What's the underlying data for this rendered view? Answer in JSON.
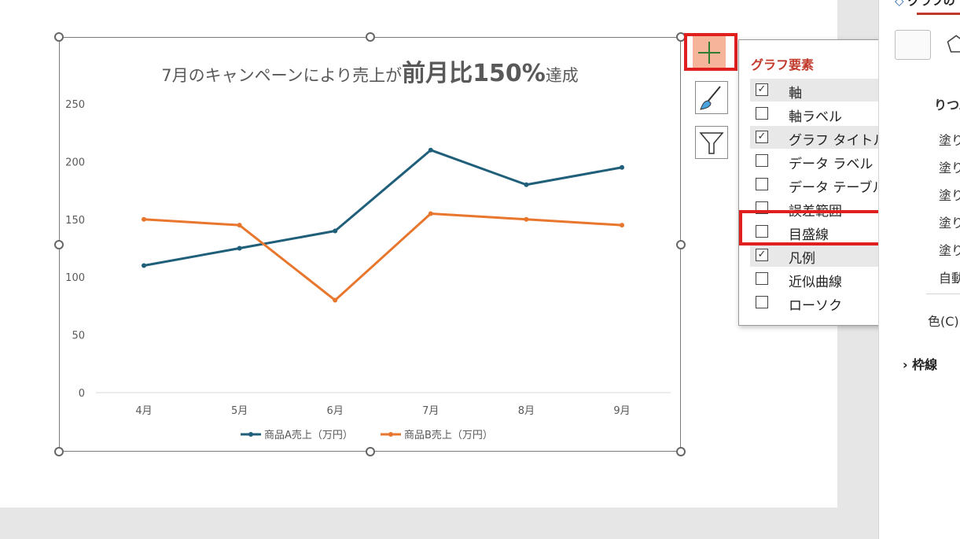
{
  "chart": {
    "title_normal": "7月のキャンペーンにより売上が",
    "title_bold": "前月比150%",
    "title_tail": "達成"
  },
  "chart_data": {
    "type": "line",
    "categories": [
      "4月",
      "5月",
      "6月",
      "7月",
      "8月",
      "9月"
    ],
    "series": [
      {
        "name": "商品A売上（万円）",
        "color": "#1f5f7a",
        "values": [
          110,
          125,
          140,
          210,
          180,
          195
        ]
      },
      {
        "name": "商品B売上（万円）",
        "color": "#e8762d",
        "values": [
          150,
          145,
          80,
          155,
          150,
          145
        ]
      }
    ],
    "yticks": [
      0,
      50,
      100,
      150,
      200,
      250
    ],
    "ylim": [
      0,
      250
    ],
    "grid": false,
    "legend_position": "bottom",
    "title": "7月のキャンペーンにより売上が前月比150%達成"
  },
  "side_buttons": {
    "add_element": "chart-elements-plus-icon",
    "styles": "paintbrush-icon",
    "filter": "funnel-icon"
  },
  "popup": {
    "title": "グラフ要素",
    "items": [
      {
        "label": "軸",
        "checked": true
      },
      {
        "label": "軸ラベル",
        "checked": false
      },
      {
        "label": "グラフ タイトル",
        "checked": true
      },
      {
        "label": "データ ラベル",
        "checked": false
      },
      {
        "label": "データ テーブル",
        "checked": false
      },
      {
        "label": "誤差範囲",
        "checked": false
      },
      {
        "label": "目盛線",
        "checked": false
      },
      {
        "label": "凡例",
        "checked": true
      },
      {
        "label": "近似曲線",
        "checked": false
      },
      {
        "label": "ローソク",
        "checked": false
      }
    ],
    "gridlines_chevron": ">"
  },
  "right_pane": {
    "title": "グラフの",
    "section": "りつぶ",
    "rows": [
      "塗り",
      "塗り",
      "塗り",
      "塗り",
      "塗り",
      "自動"
    ],
    "color_label": "色(C)",
    "border_label": "枠線",
    "chevron": "›"
  }
}
